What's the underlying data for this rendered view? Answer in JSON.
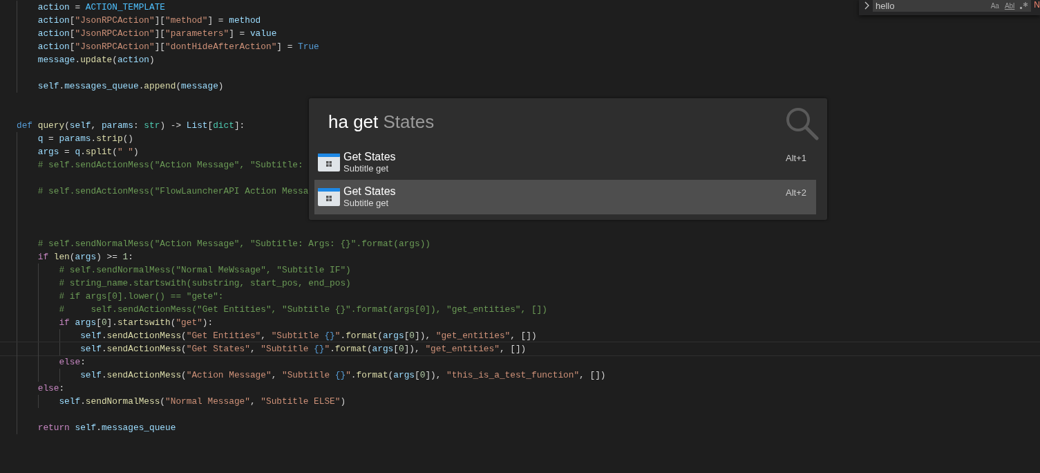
{
  "editor": {
    "lines": [
      {
        "kind": "code",
        "current": false,
        "segments": [
          {
            "text": "    action",
            "kind": "variable"
          },
          {
            "text": " = ",
            "kind": "plain"
          },
          {
            "text": "ACTION_TEMPLATE",
            "kind": "constant"
          }
        ]
      },
      {
        "kind": "code",
        "current": false,
        "segments": [
          {
            "text": "    action",
            "kind": "variable"
          },
          {
            "text": "[",
            "kind": "plain"
          },
          {
            "text": "\"JsonRPCAction\"",
            "kind": "string"
          },
          {
            "text": "][",
            "kind": "plain"
          },
          {
            "text": "\"method\"",
            "kind": "string"
          },
          {
            "text": "] = ",
            "kind": "plain"
          },
          {
            "text": "method",
            "kind": "variable"
          }
        ]
      },
      {
        "kind": "code",
        "current": false,
        "segments": [
          {
            "text": "    action",
            "kind": "variable"
          },
          {
            "text": "[",
            "kind": "plain"
          },
          {
            "text": "\"JsonRPCAction\"",
            "kind": "string"
          },
          {
            "text": "][",
            "kind": "plain"
          },
          {
            "text": "\"parameters\"",
            "kind": "string"
          },
          {
            "text": "] = ",
            "kind": "plain"
          },
          {
            "text": "value",
            "kind": "variable"
          }
        ]
      },
      {
        "kind": "code",
        "current": false,
        "segments": [
          {
            "text": "    action",
            "kind": "variable"
          },
          {
            "text": "[",
            "kind": "plain"
          },
          {
            "text": "\"JsonRPCAction\"",
            "kind": "string"
          },
          {
            "text": "][",
            "kind": "plain"
          },
          {
            "text": "\"dontHideAfterAction\"",
            "kind": "string"
          },
          {
            "text": "] = ",
            "kind": "plain"
          },
          {
            "text": "True",
            "kind": "keyword"
          }
        ]
      },
      {
        "kind": "code",
        "current": false,
        "segments": [
          {
            "text": "    message",
            "kind": "variable"
          },
          {
            "text": ".",
            "kind": "plain"
          },
          {
            "text": "update",
            "kind": "function"
          },
          {
            "text": "(",
            "kind": "plain"
          },
          {
            "text": "action",
            "kind": "variable"
          },
          {
            "text": ")",
            "kind": "plain"
          }
        ]
      },
      {
        "kind": "blank",
        "current": false
      },
      {
        "kind": "code",
        "current": false,
        "segments": [
          {
            "text": "    self",
            "kind": "variable"
          },
          {
            "text": ".",
            "kind": "plain"
          },
          {
            "text": "messages_queue",
            "kind": "variable"
          },
          {
            "text": ".",
            "kind": "plain"
          },
          {
            "text": "append",
            "kind": "function"
          },
          {
            "text": "(",
            "kind": "plain"
          },
          {
            "text": "message",
            "kind": "variable"
          },
          {
            "text": ")",
            "kind": "plain"
          }
        ]
      },
      {
        "kind": "blank",
        "current": false
      },
      {
        "kind": "blank",
        "current": false
      },
      {
        "kind": "code",
        "current": false,
        "segments": [
          {
            "text": "def",
            "kind": "keyword"
          },
          {
            "text": " query",
            "kind": "function"
          },
          {
            "text": "(",
            "kind": "plain"
          },
          {
            "text": "self",
            "kind": "variable"
          },
          {
            "text": ", ",
            "kind": "plain"
          },
          {
            "text": "params",
            "kind": "variable"
          },
          {
            "text": ": ",
            "kind": "plain"
          },
          {
            "text": "str",
            "kind": "type"
          },
          {
            "text": ") -> ",
            "kind": "plain"
          },
          {
            "text": "List",
            "kind": "variable"
          },
          {
            "text": "[",
            "kind": "plain"
          },
          {
            "text": "dict",
            "kind": "type"
          },
          {
            "text": "]:",
            "kind": "plain"
          }
        ]
      },
      {
        "kind": "code",
        "current": false,
        "segments": [
          {
            "text": "    q",
            "kind": "variable"
          },
          {
            "text": " = ",
            "kind": "plain"
          },
          {
            "text": "params",
            "kind": "variable"
          },
          {
            "text": ".",
            "kind": "plain"
          },
          {
            "text": "strip",
            "kind": "function"
          },
          {
            "text": "()",
            "kind": "plain"
          }
        ]
      },
      {
        "kind": "code",
        "current": false,
        "segments": [
          {
            "text": "    args",
            "kind": "variable"
          },
          {
            "text": " = ",
            "kind": "plain"
          },
          {
            "text": "q",
            "kind": "variable"
          },
          {
            "text": ".",
            "kind": "plain"
          },
          {
            "text": "split",
            "kind": "function"
          },
          {
            "text": "(",
            "kind": "plain"
          },
          {
            "text": "\" \"",
            "kind": "string"
          },
          {
            "text": ")",
            "kind": "plain"
          }
        ]
      },
      {
        "kind": "code",
        "current": false,
        "segments": [
          {
            "text": "    # self.sendActionMess(\"Action Message\", \"Subtitle:",
            "kind": "comment"
          }
        ]
      },
      {
        "kind": "blank",
        "current": false
      },
      {
        "kind": "code",
        "current": false,
        "segments": [
          {
            "text": "    # self.sendActionMess(\"FlowLauncherAPI Action Messa",
            "kind": "comment"
          }
        ]
      },
      {
        "kind": "blank",
        "current": false
      },
      {
        "kind": "blank",
        "current": false
      },
      {
        "kind": "blank",
        "current": false
      },
      {
        "kind": "code",
        "current": false,
        "segments": [
          {
            "text": "    # self.sendNormalMess(\"Action Message\", \"Subtitle: Args: {}\".format(args))",
            "kind": "comment"
          }
        ]
      },
      {
        "kind": "code",
        "current": false,
        "segments": [
          {
            "text": "    if",
            "kind": "control"
          },
          {
            "text": " len",
            "kind": "function"
          },
          {
            "text": "(",
            "kind": "plain"
          },
          {
            "text": "args",
            "kind": "variable"
          },
          {
            "text": ") >= ",
            "kind": "plain"
          },
          {
            "text": "1",
            "kind": "number"
          },
          {
            "text": ":",
            "kind": "plain"
          }
        ]
      },
      {
        "kind": "code",
        "current": false,
        "segments": [
          {
            "text": "        # self.sendNormalMess(\"Normal MeWssage\", \"Subtitle IF\")",
            "kind": "comment"
          }
        ]
      },
      {
        "kind": "code",
        "current": false,
        "segments": [
          {
            "text": "        # string_name.startswith(substring, start_pos, end_pos)",
            "kind": "comment"
          }
        ]
      },
      {
        "kind": "code",
        "current": false,
        "segments": [
          {
            "text": "        # if args[0].lower() == \"gete\":",
            "kind": "comment"
          }
        ]
      },
      {
        "kind": "code",
        "current": false,
        "segments": [
          {
            "text": "        #     self.sendActionMess(\"Get Entities\", \"Subtitle {}\".format(args[0]), \"get_entities\", [])",
            "kind": "comment"
          }
        ]
      },
      {
        "kind": "code",
        "current": false,
        "segments": [
          {
            "text": "        if",
            "kind": "control"
          },
          {
            "text": " args",
            "kind": "variable"
          },
          {
            "text": "[",
            "kind": "plain"
          },
          {
            "text": "0",
            "kind": "number"
          },
          {
            "text": "].",
            "kind": "plain"
          },
          {
            "text": "startswith",
            "kind": "function"
          },
          {
            "text": "(",
            "kind": "plain"
          },
          {
            "text": "\"get\"",
            "kind": "string"
          },
          {
            "text": "):",
            "kind": "plain"
          }
        ]
      },
      {
        "kind": "code",
        "current": false,
        "segments": [
          {
            "text": "            self",
            "kind": "variable"
          },
          {
            "text": ".",
            "kind": "plain"
          },
          {
            "text": "sendActionMess",
            "kind": "function"
          },
          {
            "text": "(",
            "kind": "plain"
          },
          {
            "text": "\"Get Entities\"",
            "kind": "string"
          },
          {
            "text": ", ",
            "kind": "plain"
          },
          {
            "text": "\"Subtitle ",
            "kind": "string"
          },
          {
            "text": "{}",
            "kind": "keyword"
          },
          {
            "text": "\"",
            "kind": "string"
          },
          {
            "text": ".",
            "kind": "plain"
          },
          {
            "text": "format",
            "kind": "function"
          },
          {
            "text": "(",
            "kind": "plain"
          },
          {
            "text": "args",
            "kind": "variable"
          },
          {
            "text": "[",
            "kind": "plain"
          },
          {
            "text": "0",
            "kind": "number"
          },
          {
            "text": "]), ",
            "kind": "plain"
          },
          {
            "text": "\"get_entities\"",
            "kind": "string"
          },
          {
            "text": ", [])",
            "kind": "plain"
          }
        ]
      },
      {
        "kind": "code",
        "current": true,
        "segments": [
          {
            "text": "            self",
            "kind": "variable"
          },
          {
            "text": ".",
            "kind": "plain"
          },
          {
            "text": "sendActionMess",
            "kind": "function"
          },
          {
            "text": "(",
            "kind": "plain"
          },
          {
            "text": "\"Get States\"",
            "kind": "string"
          },
          {
            "text": ", ",
            "kind": "plain"
          },
          {
            "text": "\"Subtitle ",
            "kind": "string"
          },
          {
            "text": "{}",
            "kind": "keyword"
          },
          {
            "text": "\"",
            "kind": "string"
          },
          {
            "text": ".",
            "kind": "plain"
          },
          {
            "text": "format",
            "kind": "function"
          },
          {
            "text": "(",
            "kind": "plain"
          },
          {
            "text": "args",
            "kind": "variable"
          },
          {
            "text": "[",
            "kind": "plain"
          },
          {
            "text": "0",
            "kind": "number"
          },
          {
            "text": "]), ",
            "kind": "plain"
          },
          {
            "text": "\"get_entities\"",
            "kind": "string"
          },
          {
            "text": ", [])",
            "kind": "plain"
          }
        ]
      },
      {
        "kind": "code",
        "current": false,
        "segments": [
          {
            "text": "        else",
            "kind": "control"
          },
          {
            "text": ":",
            "kind": "plain"
          }
        ]
      },
      {
        "kind": "code",
        "current": false,
        "segments": [
          {
            "text": "            self",
            "kind": "variable"
          },
          {
            "text": ".",
            "kind": "plain"
          },
          {
            "text": "sendActionMess",
            "kind": "function"
          },
          {
            "text": "(",
            "kind": "plain"
          },
          {
            "text": "\"Action Message\"",
            "kind": "string"
          },
          {
            "text": ", ",
            "kind": "plain"
          },
          {
            "text": "\"Subtitle ",
            "kind": "string"
          },
          {
            "text": "{}",
            "kind": "keyword"
          },
          {
            "text": "\"",
            "kind": "string"
          },
          {
            "text": ".",
            "kind": "plain"
          },
          {
            "text": "format",
            "kind": "function"
          },
          {
            "text": "(",
            "kind": "plain"
          },
          {
            "text": "args",
            "kind": "variable"
          },
          {
            "text": "[",
            "kind": "plain"
          },
          {
            "text": "0",
            "kind": "number"
          },
          {
            "text": "]), ",
            "kind": "plain"
          },
          {
            "text": "\"this_is_a_test_function\"",
            "kind": "string"
          },
          {
            "text": ", [])",
            "kind": "plain"
          }
        ]
      },
      {
        "kind": "code",
        "current": false,
        "segments": [
          {
            "text": "    else",
            "kind": "control"
          },
          {
            "text": ":",
            "kind": "plain"
          }
        ]
      },
      {
        "kind": "code",
        "current": false,
        "segments": [
          {
            "text": "        self",
            "kind": "variable"
          },
          {
            "text": ".",
            "kind": "plain"
          },
          {
            "text": "sendNormalMess",
            "kind": "function"
          },
          {
            "text": "(",
            "kind": "plain"
          },
          {
            "text": "\"Normal Message\"",
            "kind": "string"
          },
          {
            "text": ", ",
            "kind": "plain"
          },
          {
            "text": "\"Subtitle ELSE\"",
            "kind": "string"
          },
          {
            "text": ")",
            "kind": "plain"
          }
        ]
      },
      {
        "kind": "blank",
        "current": false
      },
      {
        "kind": "code",
        "current": false,
        "segments": [
          {
            "text": "    return",
            "kind": "control"
          },
          {
            "text": " self",
            "kind": "variable"
          },
          {
            "text": ".",
            "kind": "plain"
          },
          {
            "text": "messages_queue",
            "kind": "variable"
          }
        ]
      }
    ]
  },
  "find_widget": {
    "value": "hello",
    "options": [
      "Aa",
      "Abl"
    ],
    "status": "N"
  },
  "launcher": {
    "query": {
      "typed": "ha get",
      "suggestion": "States"
    },
    "results": [
      {
        "title": "Get States",
        "subtitle": "Subtitle get",
        "hotkey": "Alt+1",
        "selected": false
      },
      {
        "title": "Get States",
        "subtitle": "Subtitle get",
        "hotkey": "Alt+2",
        "selected": true
      }
    ]
  }
}
